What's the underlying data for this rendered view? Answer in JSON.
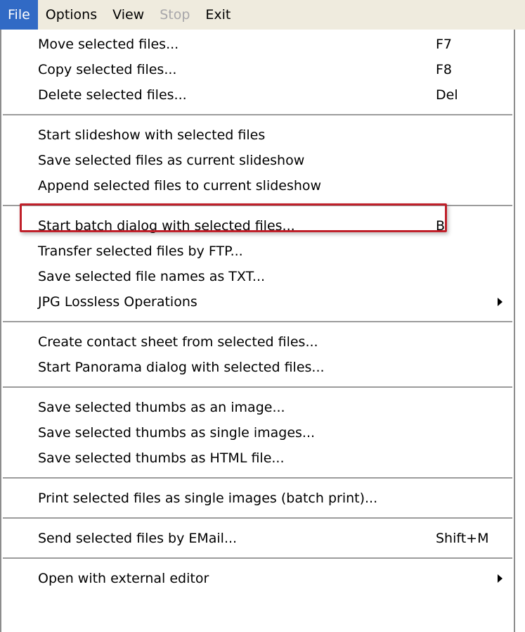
{
  "menubar": {
    "file": "File",
    "options": "Options",
    "view": "View",
    "stop": "Stop",
    "exit": "Exit"
  },
  "menu": {
    "groups": [
      [
        {
          "label": "Move selected files...",
          "shortcut": "F7"
        },
        {
          "label": "Copy selected files...",
          "shortcut": "F8"
        },
        {
          "label": "Delete selected files...",
          "shortcut": "Del"
        }
      ],
      [
        {
          "label": "Start slideshow with selected files"
        },
        {
          "label": "Save selected files as current slideshow"
        },
        {
          "label": "Append selected files to current slideshow"
        }
      ],
      [
        {
          "label": "Start batch dialog with selected files...",
          "shortcut": "B",
          "highlighted": true
        },
        {
          "label": "Transfer selected files by FTP..."
        },
        {
          "label": "Save selected file names as TXT..."
        },
        {
          "label": "JPG Lossless Operations",
          "submenu": true
        }
      ],
      [
        {
          "label": "Create contact sheet from selected files..."
        },
        {
          "label": "Start Panorama dialog with selected files..."
        }
      ],
      [
        {
          "label": "Save selected thumbs as an image..."
        },
        {
          "label": "Save selected thumbs as single images..."
        },
        {
          "label": "Save selected thumbs as HTML file..."
        }
      ],
      [
        {
          "label": "Print selected files as single images (batch print)..."
        }
      ],
      [
        {
          "label": "Send selected files by EMail...",
          "shortcut": "Shift+M"
        }
      ],
      [
        {
          "label": "Open with external editor",
          "submenu": true
        }
      ]
    ]
  },
  "colors": {
    "menubar_bg": "#efebde",
    "active_bg": "#316ac5",
    "disabled_text": "#a7a6aa",
    "highlight_border": "#c0202a"
  }
}
